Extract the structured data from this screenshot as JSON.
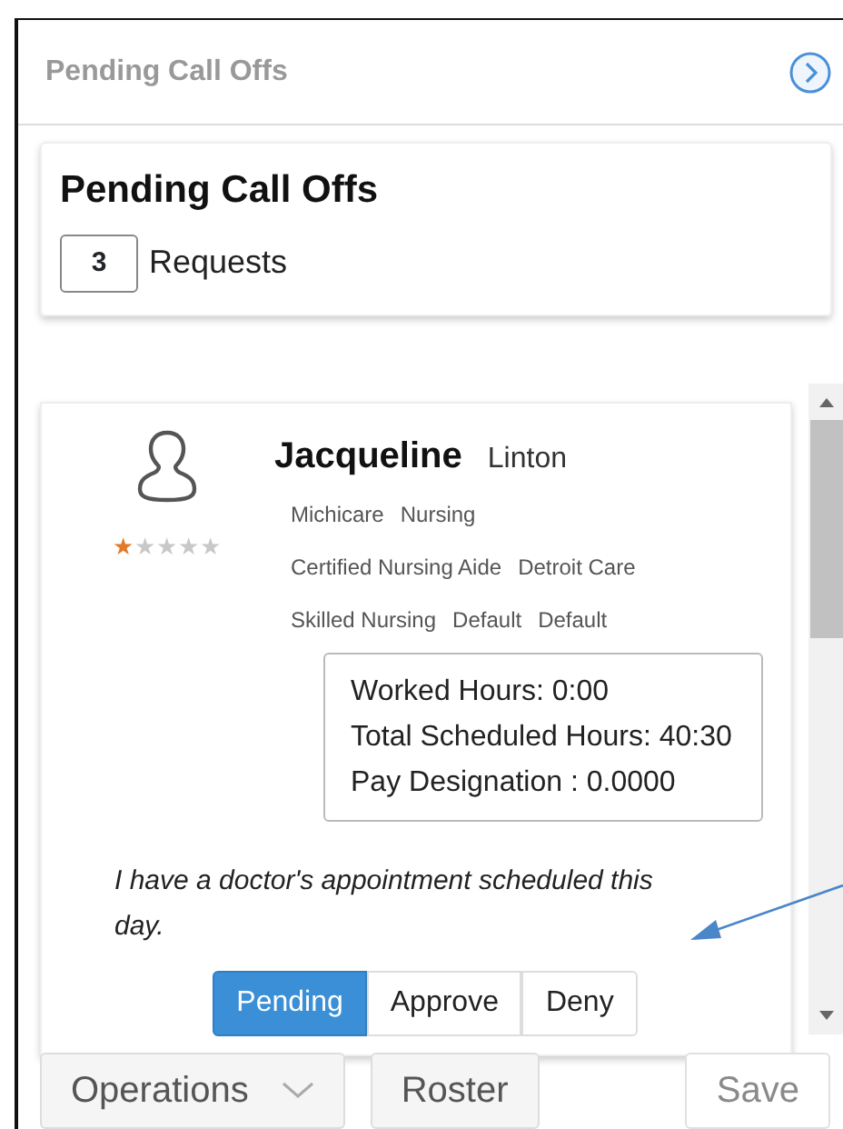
{
  "header": {
    "title": "Pending Call Offs"
  },
  "summary": {
    "title": "Pending Call Offs",
    "count": "3",
    "count_label": "Requests"
  },
  "requests": [
    {
      "first_name": "Jacqueline",
      "last_name": "Linton",
      "stars": 1,
      "tags": [
        [
          "Michicare",
          "Nursing"
        ],
        [
          "Certified Nursing Aide",
          "Detroit Care"
        ],
        [
          "Skilled Nursing",
          "Default",
          "Default"
        ]
      ],
      "hours": [
        "Worked Hours: 0:00",
        "Total Scheduled Hours: 40:30",
        "Pay Designation : 0.0000"
      ],
      "reason": "I have a doctor's appointment scheduled this day.",
      "statuses": [
        {
          "label": "Pending",
          "selected": true
        },
        {
          "label": "Approve",
          "selected": false
        },
        {
          "label": "Deny",
          "selected": false
        }
      ]
    }
  ],
  "footer": {
    "buttons": [
      {
        "label": "Operations",
        "kind": "dropdown",
        "disabled": false
      },
      {
        "label": "Roster",
        "kind": "plain",
        "disabled": false
      },
      {
        "label": "Save",
        "kind": "plain",
        "disabled": true
      }
    ]
  }
}
